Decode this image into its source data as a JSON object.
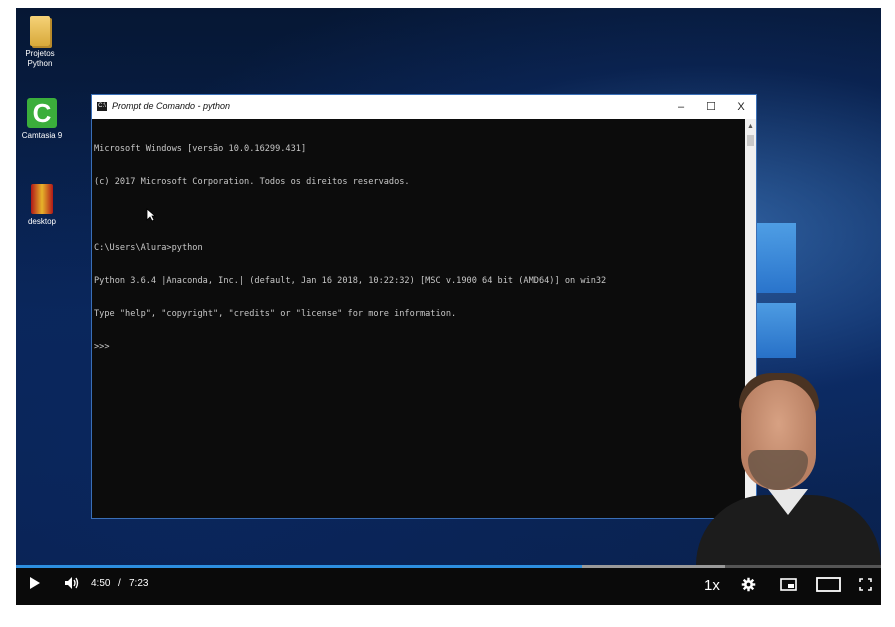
{
  "desktop": {
    "icons": [
      {
        "label_line1": "Projetos",
        "label_line2": "Python",
        "icon": "folder-icon"
      },
      {
        "label_line1": "Camtasia 9",
        "label_line2": "",
        "icon": "camtasia-icon"
      },
      {
        "label_line1": "desktop",
        "label_line2": "",
        "icon": "winrar-archive-icon"
      }
    ]
  },
  "window": {
    "title": "Prompt de Comando - python",
    "minimize": "–",
    "maximize": "☐",
    "close": "X",
    "console_lines": [
      "Microsoft Windows [versão 10.0.16299.431]",
      "(c) 2017 Microsoft Corporation. Todos os direitos reservados.",
      "",
      "C:\\Users\\Alura>python",
      "Python 3.6.4 |Anaconda, Inc.| (default, Jan 16 2018, 10:22:32) [MSC v.1900 64 bit (AMD64)] on win32",
      "Type \"help\", \"copyright\", \"credits\" or \"license\" for more information.",
      ">>>"
    ]
  },
  "player": {
    "time_current": "4:50",
    "time_separator": "/",
    "time_total": "7:23",
    "speed": "1x",
    "progress_fraction": 0.654,
    "loaded_fraction": 0.82,
    "accent_color": "#2d8fe0"
  }
}
